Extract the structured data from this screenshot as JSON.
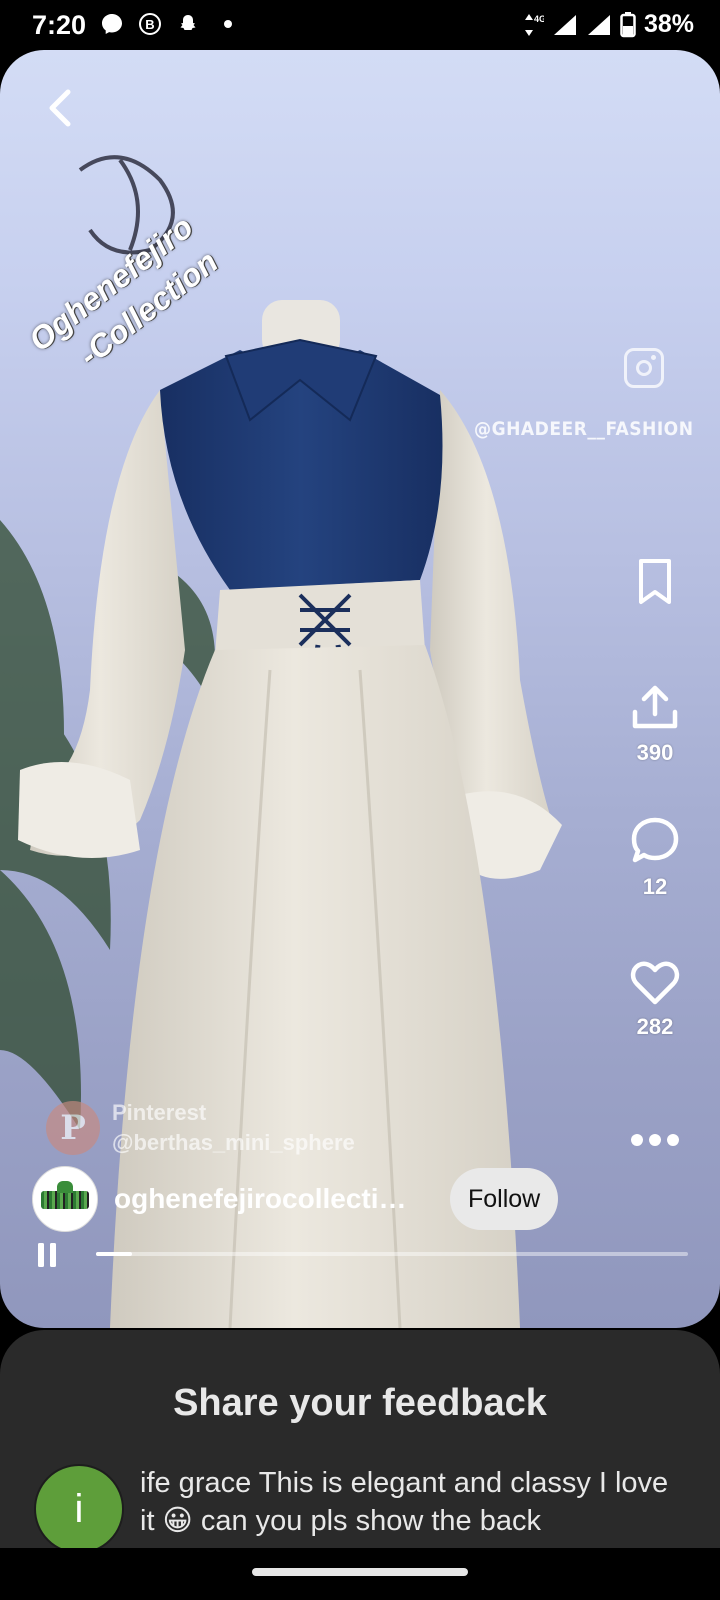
{
  "status_bar": {
    "time": "7:20",
    "network": "4G",
    "battery": "38%",
    "icons": [
      "messenger-icon",
      "bitcoin-b-icon",
      "snapchat-ghost-icon",
      "notification-dot-icon",
      "data-arrows-icon",
      "signal-icon",
      "battery-icon"
    ]
  },
  "pin": {
    "back_icon": "chevron-left-icon",
    "watermark_line1": "Oghenefejiro",
    "watermark_line2": "-Collection",
    "instagram_handle": "@GHADEER__FASHION",
    "pinterest_label": "Pinterest",
    "pinterest_handle": "@berthas_mini_sphere",
    "video_progress": 0.06,
    "colors": {
      "sky": "#c7d0ef",
      "navy": "#1f3a73",
      "cream": "#e6e2d8"
    }
  },
  "actions": {
    "save_icon": "bookmark-icon",
    "share_icon": "share-upload-icon",
    "share_count": "390",
    "comment_icon": "comment-bubble-icon",
    "comment_count": "12",
    "like_icon": "heart-icon",
    "like_count": "282",
    "more_icon": "more-dots-icon"
  },
  "creator": {
    "name": "oghenefejirocollecti…",
    "follow_label": "Follow"
  },
  "feedback": {
    "title": "Share your feedback",
    "avatar_initial": "i",
    "avatar_color": "#5e9e3a",
    "comment": "ife grace This is elegant and classy I love it 😀 can you pls show the back"
  }
}
